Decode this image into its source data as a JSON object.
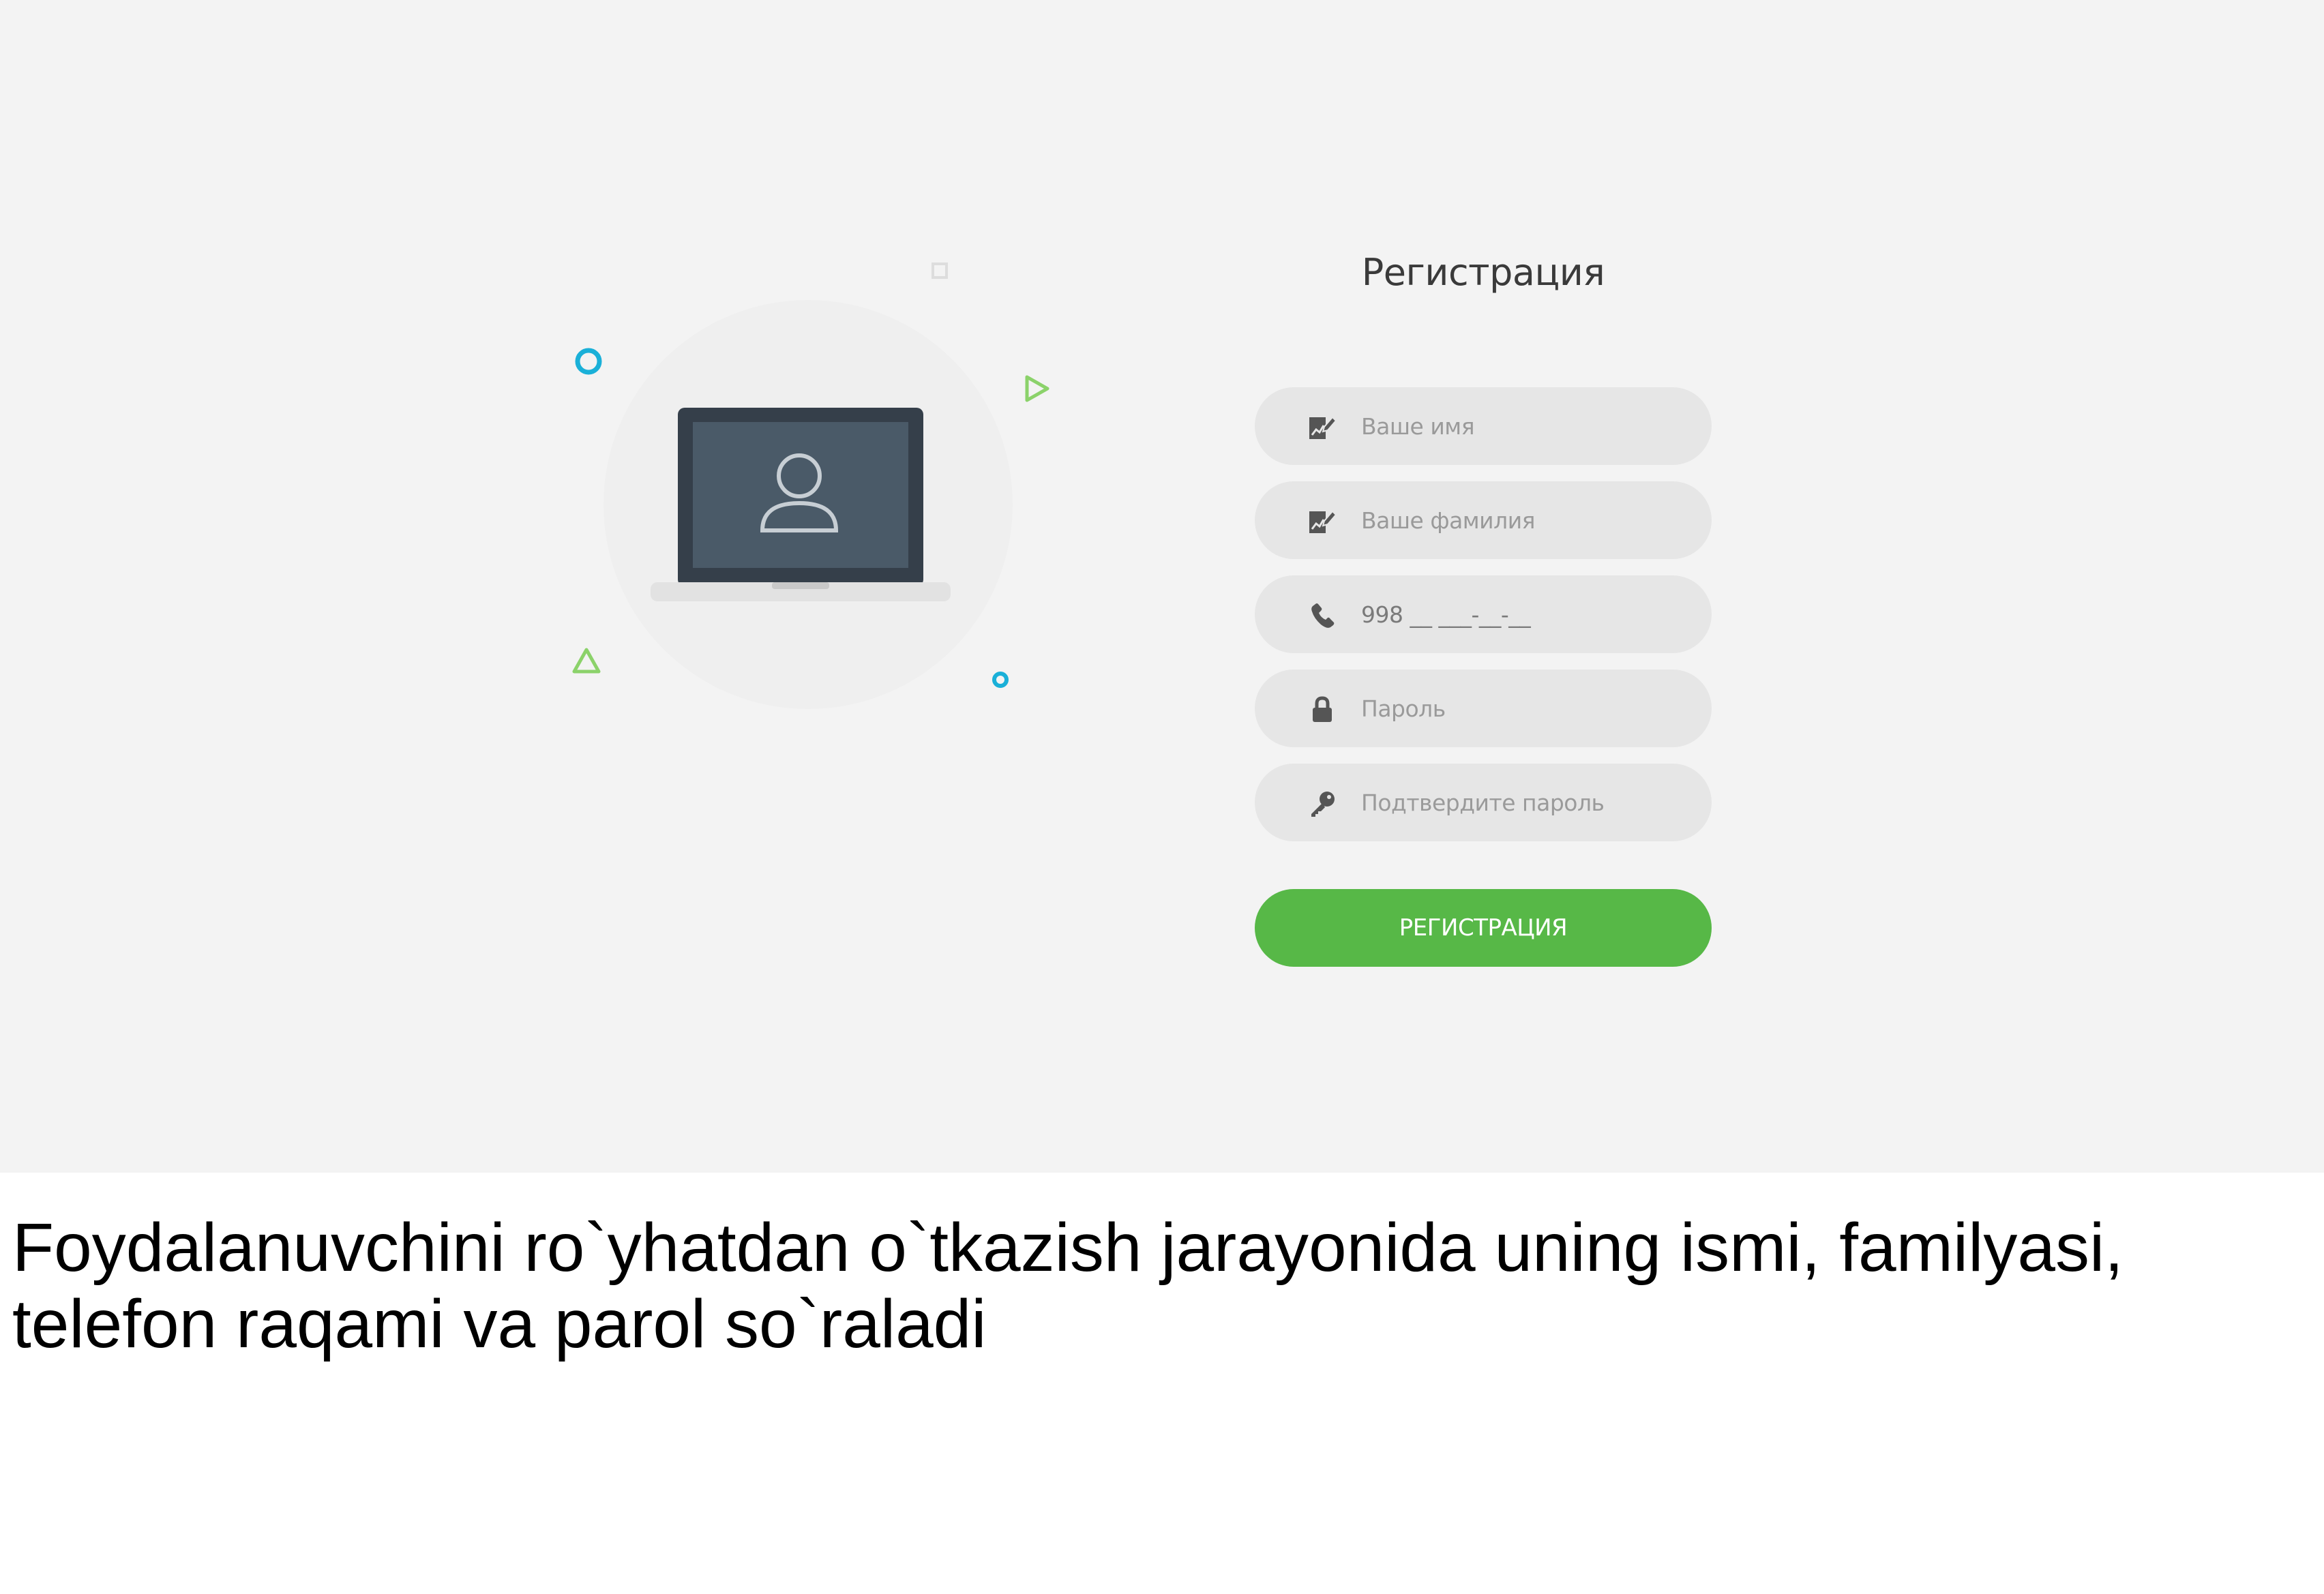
{
  "form": {
    "title": "Регистрация",
    "fields": [
      {
        "icon": "edit-icon",
        "placeholder": "Ваше имя",
        "value": ""
      },
      {
        "icon": "edit-icon",
        "placeholder": "Ваше фамилия",
        "value": ""
      },
      {
        "icon": "phone-icon",
        "placeholder": "",
        "value": "998 __ ___-__-__"
      },
      {
        "icon": "lock-icon",
        "placeholder": "Пароль",
        "value": ""
      },
      {
        "icon": "key-icon",
        "placeholder": "Подтвердите пароль",
        "value": ""
      }
    ],
    "submit_label": "РЕГИСТРАЦИЯ"
  },
  "illustration": {
    "icon": "laptop-user-icon"
  },
  "colors": {
    "background": "#f3f3f3",
    "field_background": "#e6e6e6",
    "accent_green": "#57b847",
    "decor_blue": "#1ab0d8",
    "decor_green": "#8bd26a",
    "laptop_frame": "#353f4a",
    "laptop_screen": "#4a5a68"
  },
  "caption": {
    "text": "Foydalanuvchini ro`yhatdan o`tkazish jarayonida uning ismi, familyasi, telefon raqami va parol so`raladi"
  }
}
